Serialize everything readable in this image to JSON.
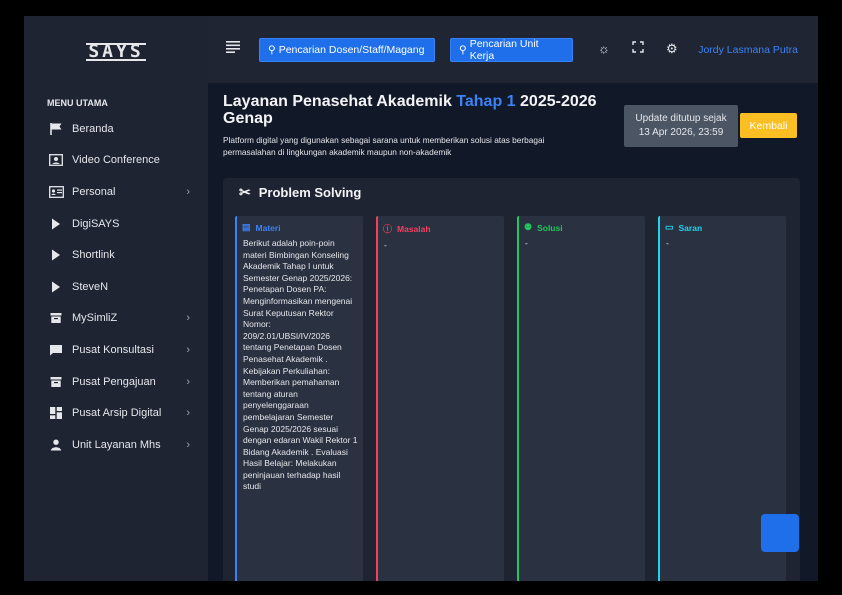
{
  "app": {
    "logo": "SAYS"
  },
  "topbar": {
    "search_staff": "Pencarian Dosen/Staff/Magang",
    "search_unit": "Pencarian Unit Kerja",
    "user_name": "Jordy Lasmana Putra"
  },
  "sidebar": {
    "title": "MENU UTAMA",
    "items": [
      {
        "label": "Beranda",
        "icon": "flag-icon",
        "has_children": false
      },
      {
        "label": "Video Conference",
        "icon": "video-icon",
        "has_children": false
      },
      {
        "label": "Personal",
        "icon": "id-card-icon",
        "has_children": true
      },
      {
        "label": "DigiSAYS",
        "icon": "play-icon",
        "has_children": false
      },
      {
        "label": "Shortlink",
        "icon": "play-icon",
        "has_children": false
      },
      {
        "label": "SteveN",
        "icon": "play-icon",
        "has_children": false
      },
      {
        "label": "MySimliZ",
        "icon": "archive-icon",
        "has_children": true
      },
      {
        "label": "Pusat Konsultasi",
        "icon": "chat-icon",
        "has_children": true
      },
      {
        "label": "Pusat Pengajuan",
        "icon": "archive-icon",
        "has_children": true
      },
      {
        "label": "Pusat Arsip Digital",
        "icon": "dashboard-icon",
        "has_children": true
      },
      {
        "label": "Unit Layanan Mhs",
        "icon": "user-icon",
        "has_children": true
      }
    ]
  },
  "page": {
    "title_prefix": "Layanan Penasehat Akademik ",
    "title_highlight": "Tahap 1",
    "title_suffix": " 2025-2026 Genap",
    "subtitle": "Platform digital yang digunakan sebagai sarana untuk memberikan solusi atas berbagai permasalahan di lingkungan akademik maupun non-akademik",
    "update_line1": "Update ditutup sejak",
    "update_line2": "13 Apr 2026, 23:59",
    "back_label": "Kembali"
  },
  "problem_solving": {
    "title": "Problem Solving",
    "columns": [
      {
        "label": "Materi",
        "color": "#3b82f6",
        "content": "Berikut adalah poin-poin materi Bimbingan Konseling Akademik Tahap I untuk Semester Genap 2025/2026: Penetapan Dosen PA: Menginformasikan mengenai Surat Keputusan Rektor Nomor: 209/2.01/UBSI/IV/2026 tentang Penetapan Dosen Penasehat Akademik . Kebijakan Perkuliahan: Memberikan pemahaman tentang aturan penyelenggaraan pembelajaran Semester Genap 2025/2026 sesuai dengan edaran Wakil Rektor 1 Bidang Akademik . Evaluasi Hasil Belajar: Melakukan peninjauan terhadap hasil studi"
      },
      {
        "label": "Masalah",
        "color": "#f43f5e",
        "content": "-"
      },
      {
        "label": "Solusi",
        "color": "#22c55e",
        "content": "-"
      },
      {
        "label": "Saran",
        "color": "#22d3ee",
        "content": "-"
      }
    ]
  }
}
